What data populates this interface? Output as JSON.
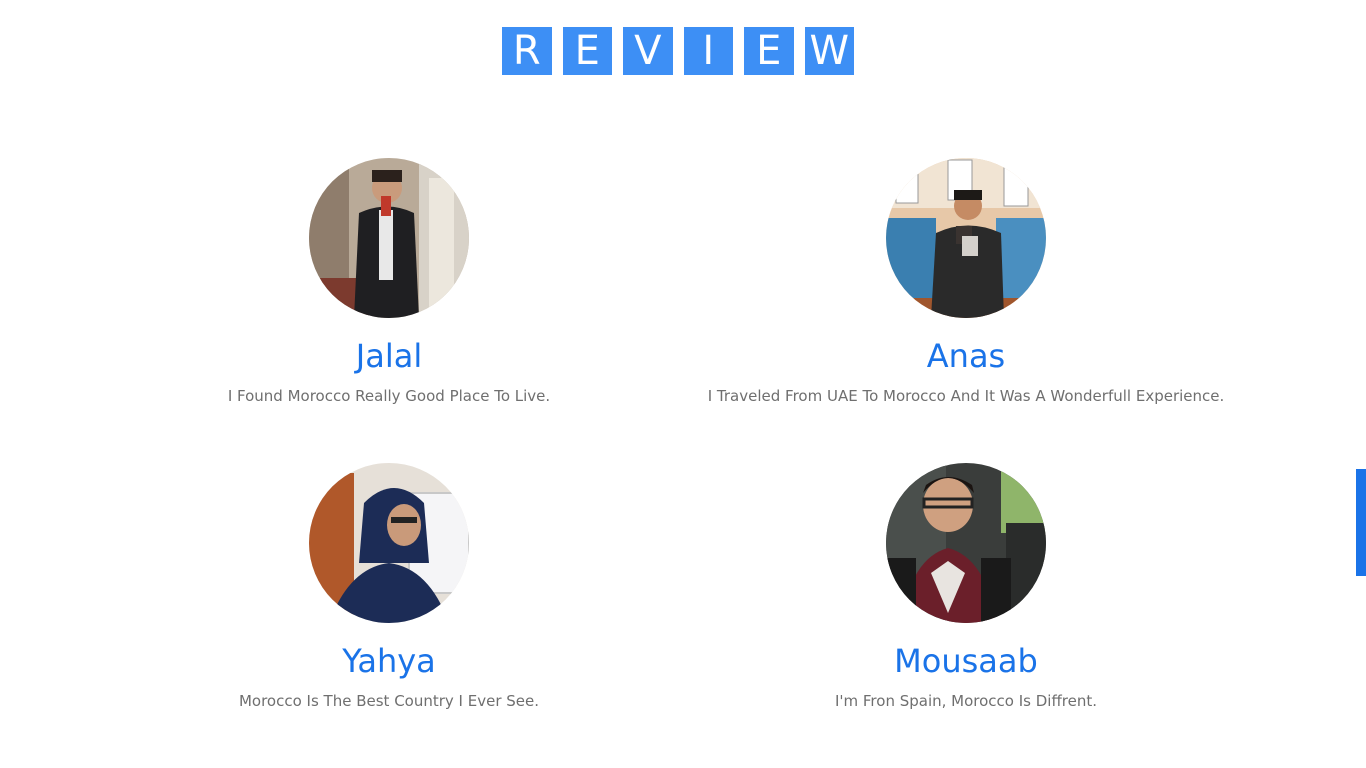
{
  "heading": {
    "letters": [
      "R",
      "E",
      "V",
      "I",
      "E",
      "W"
    ],
    "accent_color": "#3d8ff5"
  },
  "reviews": [
    {
      "name": "Jalal",
      "text": "I Found Morocco Really Good Place To Live."
    },
    {
      "name": "Anas",
      "text": "I Traveled From UAE To Morocco And It Was A Wonderfull Experience."
    },
    {
      "name": "Yahya",
      "text": "Morocco Is The Best Country I Ever See."
    },
    {
      "name": "Mousaab",
      "text": "I'm Fron Spain, Morocco Is Diffrent."
    }
  ],
  "colors": {
    "name": "#1a73e8",
    "quote": "#6f6f6f"
  }
}
